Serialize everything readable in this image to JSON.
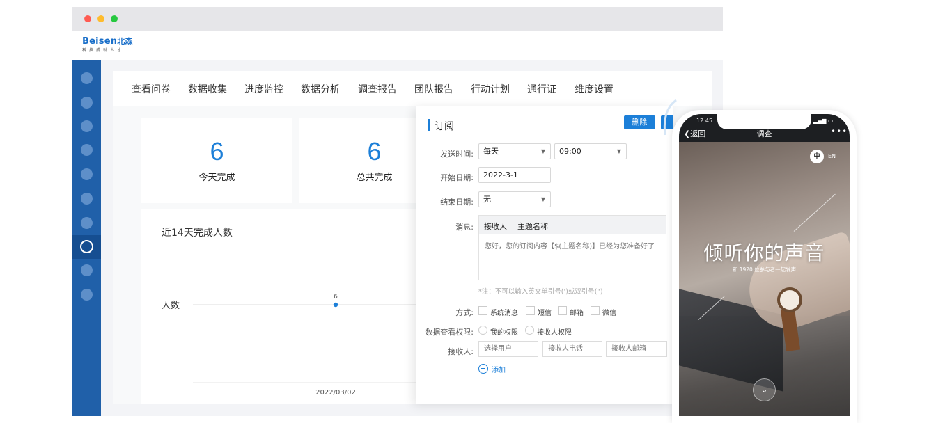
{
  "brand": {
    "name": "Beisen",
    "name_cn": "北森",
    "slogan": "科技成就人才"
  },
  "tabs": [
    "查看问卷",
    "数据收集",
    "进度监控",
    "数据分析",
    "调查报告",
    "团队报告",
    "行动计划",
    "通行证",
    "维度设置"
  ],
  "stats": [
    {
      "value": "6",
      "label": "今天完成"
    },
    {
      "value": "6",
      "label": "总共完成"
    }
  ],
  "chart_data": {
    "type": "line",
    "title": "近14天完成人数",
    "ylabel": "人数",
    "x": [
      "2022/03/02"
    ],
    "series": [
      {
        "values": [
          6
        ]
      }
    ],
    "data_labels": [
      "6"
    ]
  },
  "modal": {
    "title": "订阅",
    "delete_label": "删除",
    "send_time_label": "发送时间:",
    "frequency": "每天",
    "time": "09:00",
    "start_label": "开始日期:",
    "start_value": "2022-3-1",
    "end_label": "结束日期:",
    "end_value": "无",
    "message_label": "消息:",
    "message_tabs": [
      "接收人",
      "主题名称"
    ],
    "message_text": "您好，您的订阅内容【$(主题名称)】已经为您准备好了",
    "note": "*注：不可以输入英文单引号(')或双引号(\")",
    "method_label": "方式:",
    "methods": [
      "系统消息",
      "短信",
      "邮箱",
      "微信"
    ],
    "permission_label": "数据查看权限:",
    "permissions": [
      "我的权限",
      "接收人权限"
    ],
    "receiver_label": "接收人:",
    "receiver_placeholders": [
      "选择用户",
      "接收人电话",
      "接收人邮箱"
    ],
    "add_label": "添加"
  },
  "phone": {
    "time": "12:45",
    "back_label": "返回",
    "nav_title": "调查",
    "more": "•••",
    "lang_zh": "中",
    "lang_en": "EN",
    "hero_title": "倾听你的声音",
    "hero_subtitle": "和 1920 位参与者一起发声"
  }
}
